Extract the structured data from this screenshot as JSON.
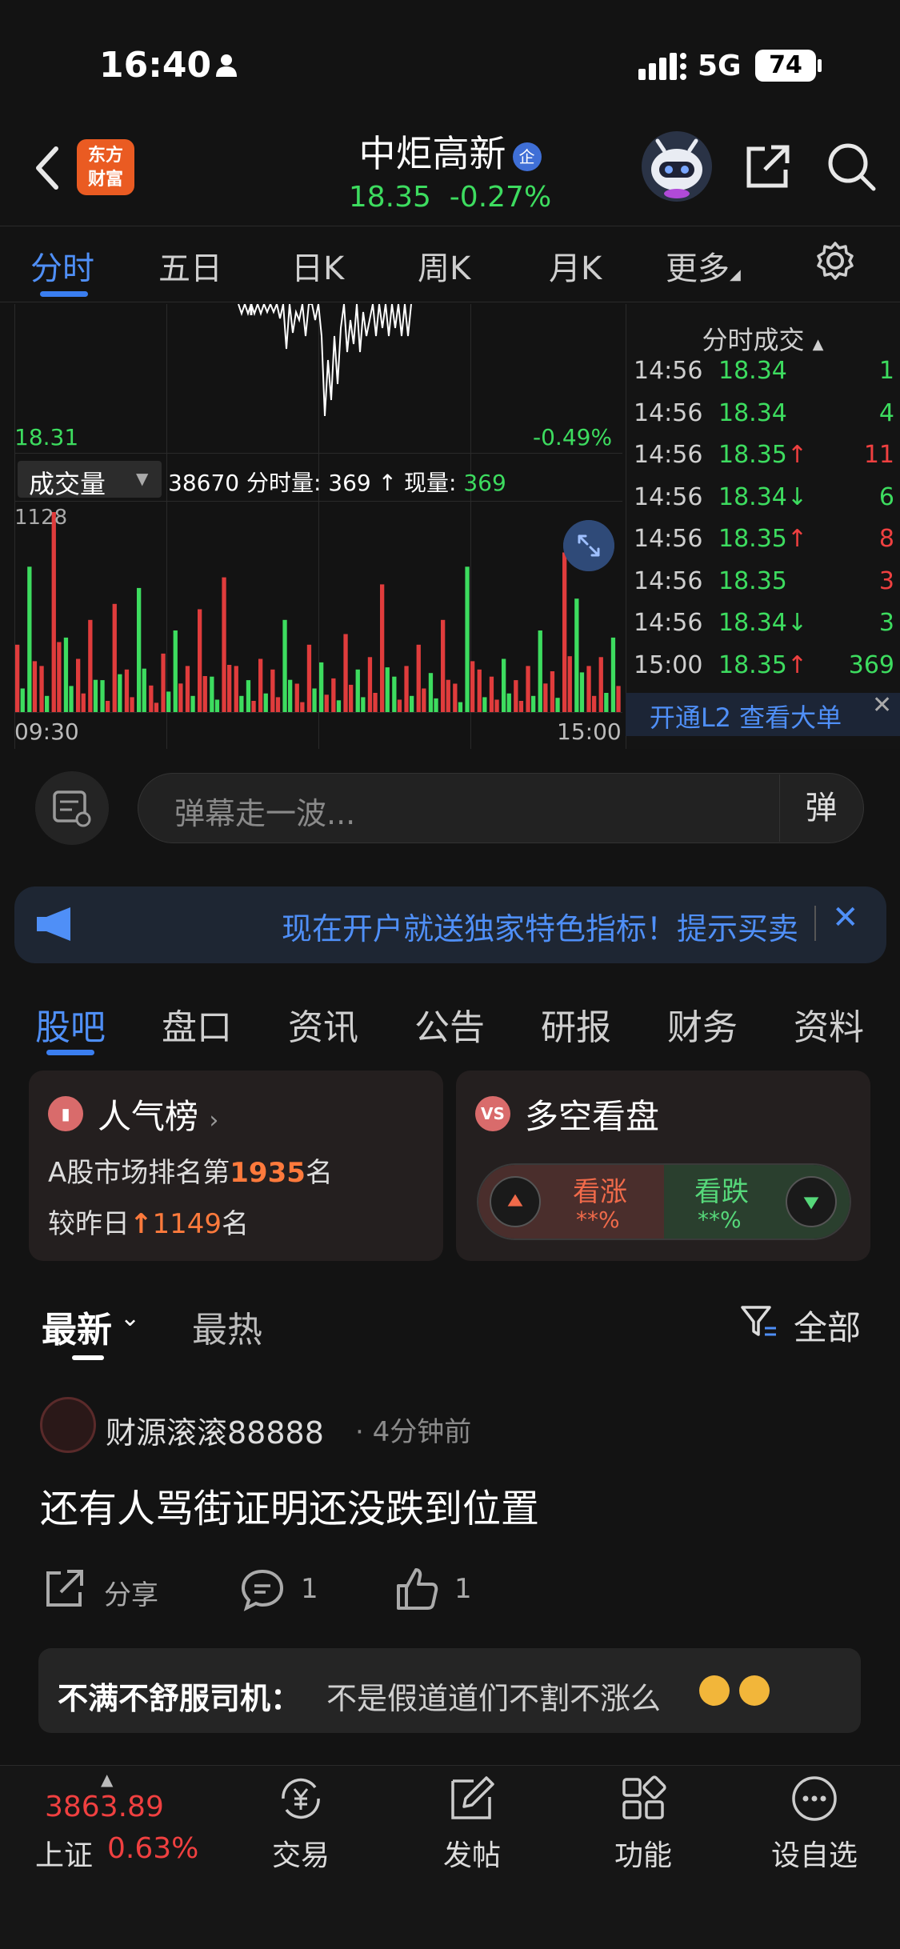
{
  "status_bar": {
    "time": "16:40",
    "network": "5G",
    "battery": "74"
  },
  "header": {
    "logo_line1": "东方",
    "logo_line2": "财富",
    "stock_name": "中炬高新",
    "badge": "企",
    "price": "18.35",
    "change": "-0.27%",
    "accent": "#3ddc5f"
  },
  "chart_tabs": [
    {
      "label": "分时",
      "active": true
    },
    {
      "label": "五日"
    },
    {
      "label": "日K"
    },
    {
      "label": "周K"
    },
    {
      "label": "月K"
    },
    {
      "label": "更多"
    }
  ],
  "intraday": {
    "price_low": "18.31",
    "pct_low": "-0.49%",
    "volume_label": "成交量",
    "volume_info_prefix": "38670 分时量: 369 ↑ 现量: ",
    "volume_info_value": "369",
    "volume_axis_max": "1128",
    "time_start": "09:30",
    "time_end": "15:00"
  },
  "chart_data": {
    "type": "bar",
    "title": "",
    "xlabel": "",
    "ylabel": "成交量",
    "ylim": [
      0,
      1128
    ],
    "x_range": [
      "09:30",
      "15:00"
    ],
    "volume_samples": [
      380,
      820,
      260,
      1128,
      420,
      300,
      520,
      180,
      610,
      240,
      700,
      150,
      330,
      460,
      260,
      580,
      200,
      760,
      260,
      180,
      300,
      240,
      520,
      160,
      380,
      280,
      190,
      440,
      240,
      310,
      720,
      200,
      260,
      380,
      220,
      520,
      160,
      820,
      240,
      200,
      300,
      180,
      260,
      460,
      230,
      900,
      640,
      260,
      310,
      420
    ]
  },
  "trades": {
    "title": "分时成交",
    "rows": [
      {
        "time": "14:56",
        "price": "18.34",
        "arrow": "",
        "vol": "1",
        "price_color": "green",
        "vol_color": "green"
      },
      {
        "time": "14:56",
        "price": "18.34",
        "arrow": "",
        "vol": "4",
        "price_color": "green",
        "vol_color": "green"
      },
      {
        "time": "14:56",
        "price": "18.35",
        "arrow": "↑",
        "vol": "11",
        "price_color": "green",
        "vol_color": "red"
      },
      {
        "time": "14:56",
        "price": "18.34",
        "arrow": "↓",
        "vol": "6",
        "price_color": "green",
        "vol_color": "green"
      },
      {
        "time": "14:56",
        "price": "18.35",
        "arrow": "↑",
        "vol": "8",
        "price_color": "green",
        "vol_color": "red"
      },
      {
        "time": "14:56",
        "price": "18.35",
        "arrow": "",
        "vol": "3",
        "price_color": "green",
        "vol_color": "red"
      },
      {
        "time": "14:56",
        "price": "18.34",
        "arrow": "↓",
        "vol": "3",
        "price_color": "green",
        "vol_color": "green"
      },
      {
        "time": "15:00",
        "price": "18.35",
        "arrow": "↑",
        "vol": "369",
        "price_color": "green",
        "vol_color": "green"
      }
    ],
    "l2_label": "开通L2 查看大单"
  },
  "danmaku": {
    "placeholder": "弹幕走一波...",
    "send_label": "弹"
  },
  "promo": {
    "text": "现在开户就送独家特色指标！提示买卖"
  },
  "section_tabs": [
    {
      "label": "股吧",
      "active": true
    },
    {
      "label": "盘口"
    },
    {
      "label": "资讯"
    },
    {
      "label": "公告"
    },
    {
      "label": "研报"
    },
    {
      "label": "财务"
    },
    {
      "label": "资料"
    }
  ],
  "popularity_card": {
    "title": "人气榜",
    "rank_prefix": "A股市场排名第",
    "rank": "1935",
    "rank_suffix": "名",
    "change_prefix": "较昨日",
    "change_value": "1149",
    "change_suffix": "名"
  },
  "vs_card": {
    "title": "多空看盘",
    "up_label": "看涨",
    "up_pct": "**%",
    "down_label": "看跌",
    "down_pct": "**%"
  },
  "feed": {
    "latest": "最新",
    "hot": "最热",
    "filter": "全部"
  },
  "post": {
    "author": "财源滚滚88888",
    "time": "· 4分钟前",
    "body": "还有人骂街证明还没跌到位置",
    "share": "分享",
    "comments": "1",
    "likes": "1",
    "comment_author": "不满不舒服司机：",
    "comment_text": "不是假道道们不割不涨么"
  },
  "bottom_nav": {
    "index_value": "3863.89",
    "index_name": "上证",
    "index_pct": "0.63%",
    "items": [
      {
        "label": "交易"
      },
      {
        "label": "发帖"
      },
      {
        "label": "功能"
      },
      {
        "label": "设自选"
      }
    ]
  }
}
